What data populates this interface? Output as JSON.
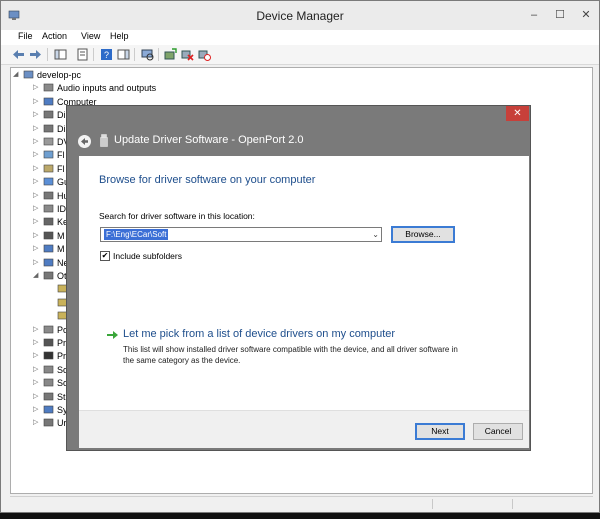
{
  "window": {
    "title": "Device Manager",
    "minimize": "–",
    "maximize": "☐",
    "close": "✕"
  },
  "menu": [
    "File",
    "Action",
    "View",
    "Help"
  ],
  "tree": {
    "root": "develop-pc",
    "items": [
      {
        "label": "Audio inputs and outputs"
      },
      {
        "label": "Computer"
      },
      {
        "label": "Di"
      },
      {
        "label": "Di"
      },
      {
        "label": "DV"
      },
      {
        "label": "Fl"
      },
      {
        "label": "Fl"
      },
      {
        "label": "Gu"
      },
      {
        "label": "Hu"
      },
      {
        "label": "ID"
      },
      {
        "label": "Ke"
      },
      {
        "label": "M"
      },
      {
        "label": "M"
      },
      {
        "label": "Ne"
      },
      {
        "label": "Ot"
      },
      {
        "label": ""
      },
      {
        "label": ""
      },
      {
        "label": ""
      },
      {
        "label": "Po"
      },
      {
        "label": "Pr"
      },
      {
        "label": "Pr"
      },
      {
        "label": "So"
      },
      {
        "label": "So"
      },
      {
        "label": "St"
      },
      {
        "label": "Sy"
      },
      {
        "label": "Ur"
      }
    ]
  },
  "dialog": {
    "title": "Update Driver Software - OpenPort 2.0",
    "close": "✕",
    "heading": "Browse for driver software on your computer",
    "search_label": "Search for driver software in this location:",
    "path_value": "F:\\Eng\\ECar\\Soft",
    "browse_label": "Browse...",
    "include_subfolders_label": "Include subfolders",
    "include_subfolders_checked": true,
    "checkmark": "✔",
    "pick_link": "Let me pick from a list of device drivers on my computer",
    "pick_desc": "This list will show installed driver software compatible with the device, and all driver software in the same category as the device.",
    "next_label": "Next",
    "cancel_label": "Cancel"
  },
  "colors": {
    "heading_blue": "#1e4e8c",
    "selection_blue": "#3b6fd6",
    "close_red": "#c7403a",
    "dialog_frame": "#7a7a7a",
    "arrow_green": "#3aa63a"
  },
  "icons": {
    "back": "back-arrow-icon",
    "forward": "forward-arrow-icon",
    "properties": "properties-icon",
    "help": "help-icon",
    "scan": "scan-hardware-icon",
    "update": "update-driver-icon",
    "uninstall": "uninstall-icon",
    "disable": "disable-icon",
    "link_arrow": "green-arrow-icon"
  }
}
